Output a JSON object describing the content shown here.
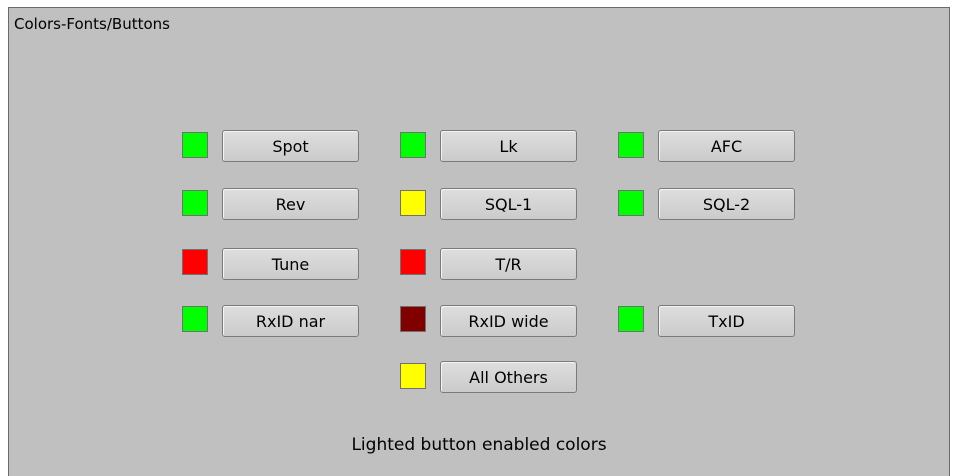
{
  "panel": {
    "title": "Colors-Fonts/Buttons",
    "caption": "Lighted button enabled colors"
  },
  "colors": {
    "green": "#00ff00",
    "yellow": "#ffff00",
    "red": "#ff0000",
    "dark_red": "#800000"
  },
  "buttons": {
    "spot": {
      "label": "Spot",
      "color": "#00ff00"
    },
    "lk": {
      "label": "Lk",
      "color": "#00ff00"
    },
    "afc": {
      "label": "AFC",
      "color": "#00ff00"
    },
    "rev": {
      "label": "Rev",
      "color": "#00ff00"
    },
    "sql1": {
      "label": "SQL-1",
      "color": "#ffff00"
    },
    "sql2": {
      "label": "SQL-2",
      "color": "#00ff00"
    },
    "tune": {
      "label": "Tune",
      "color": "#ff0000"
    },
    "tr": {
      "label": "T/R",
      "color": "#ff0000"
    },
    "rxid_nar": {
      "label": "RxID nar",
      "color": "#00ff00"
    },
    "rxid_wide": {
      "label": "RxID wide",
      "color": "#800000"
    },
    "txid": {
      "label": "TxID",
      "color": "#00ff00"
    },
    "all_others": {
      "label": "All Others",
      "color": "#ffff00"
    }
  }
}
